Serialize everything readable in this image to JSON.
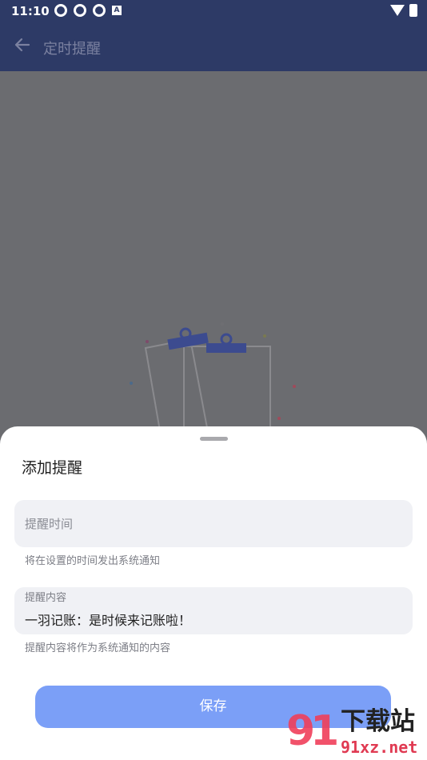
{
  "status": {
    "time": "11:10",
    "a_badge": "A"
  },
  "appbar": {
    "title": "定时提醒"
  },
  "sheet": {
    "title": "添加提醒",
    "time_field": {
      "placeholder": "提醒时间",
      "helper": "将在设置的时间发出系统通知"
    },
    "content_field": {
      "label": "提醒内容",
      "value": "一羽记账：是时候来记账啦！",
      "helper": "提醒内容将作为系统通知的内容"
    },
    "save_label": "保存"
  },
  "watermark": {
    "number": "91",
    "name": "下载站",
    "url": "91xz.net"
  },
  "colors": {
    "appbar": "#2d3a66",
    "accent": "#7b9ff7",
    "field_bg": "#f0f1f5",
    "overlay": "#6b6c70"
  }
}
